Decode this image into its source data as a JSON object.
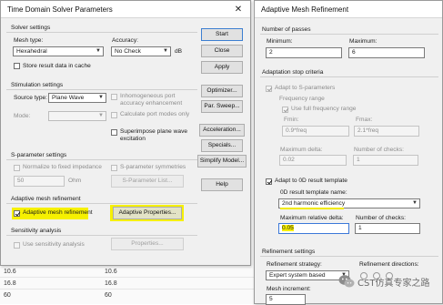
{
  "background_table": {
    "rows": [
      {
        "c1": "10.6",
        "c2": "10.6"
      },
      {
        "c1": "16.8",
        "c2": "16.8"
      },
      {
        "c1": "60",
        "c2": "60"
      }
    ]
  },
  "solver_dialog": {
    "title": "Time Domain Solver Parameters",
    "close_glyph": "✕",
    "solver_settings": {
      "heading": "Solver settings",
      "mesh_type_label": "Mesh type:",
      "mesh_type_value": "Hexahedral",
      "accuracy_label": "Accuracy:",
      "accuracy_value": "No Check",
      "accuracy_unit": "dB",
      "store_result_label": "Store result data in cache"
    },
    "stimulation_settings": {
      "heading": "Stimulation settings",
      "source_type_label": "Source type:",
      "source_type_value": "Plane Wave",
      "mode_label": "Mode:",
      "mode_value": "",
      "inhomogeneous_label": "Inhomogeneous port accuracy enhancement",
      "calc_port_modes_label": "Calculate port modes only",
      "superimpose_label": "Superimpose plane wave excitation"
    },
    "sparameter_settings": {
      "heading": "S-parameter settings",
      "normalize_label": "Normalize to fixed impedance",
      "symmetries_label": "S-parameter symmetries",
      "impedance_value": "50",
      "impedance_unit": "Ohm",
      "list_button": "S-Parameter List..."
    },
    "adaptive_mesh": {
      "heading": "Adaptive mesh refinement",
      "checkbox_label": "Adaptive mesh refinement",
      "properties_button": "Adaptive Properties..."
    },
    "sensitivity": {
      "heading": "Sensitivity analysis",
      "checkbox_label": "Use sensitivity analysis",
      "properties_button": "Properties..."
    },
    "side_buttons": {
      "start": "Start",
      "close": "Close",
      "apply": "Apply",
      "optimizer": "Optimizer...",
      "par_sweep": "Par. Sweep...",
      "acceleration": "Acceleration...",
      "specials": "Specials...",
      "simplify_model": "Simplify Model...",
      "help": "Help"
    }
  },
  "amr_dialog": {
    "title": "Adaptive Mesh Refinement",
    "number_of_passes": {
      "heading": "Number of passes",
      "minimum_label": "Minimum:",
      "minimum_value": "2",
      "maximum_label": "Maximum:",
      "maximum_value": "6"
    },
    "stop_criteria": {
      "heading": "Adaptation stop criteria",
      "adapt_sparams_label": "Adapt to S-parameters",
      "frequency_range_label": "Frequency range",
      "use_full_freq_label": "Use full frequency range",
      "fmin_label": "Fmin:",
      "fmin_value": "0.9*freq",
      "fmax_label": "Fmax:",
      "fmax_value": "2.1*freq",
      "max_delta_label": "Maximum delta:",
      "max_delta_value": "0.02",
      "num_checks_label": "Number of checks:",
      "num_checks_value": "1",
      "adapt_0d_label": "Adapt to 0D result template",
      "template_name_label": "0D result template name:",
      "template_name_value": "2nd harmonic efficiency",
      "max_rel_delta_label": "Maximum relative delta:",
      "max_rel_delta_value": "0.05",
      "num_checks2_label": "Number of checks:",
      "num_checks2_value": "1"
    },
    "refinement": {
      "heading": "Refinement settings",
      "strategy_label": "Refinement strategy:",
      "strategy_value": "Expert system based",
      "directions_label": "Refinement directions:",
      "mesh_increment_label": "Mesh increment:",
      "mesh_increment_value": "5"
    }
  },
  "watermark": {
    "text": "CST仿真专家之路"
  },
  "colors": {
    "highlight": "#f6f000",
    "dialog_bg": "#f0f0f0",
    "focus_border": "#3b78d8"
  }
}
